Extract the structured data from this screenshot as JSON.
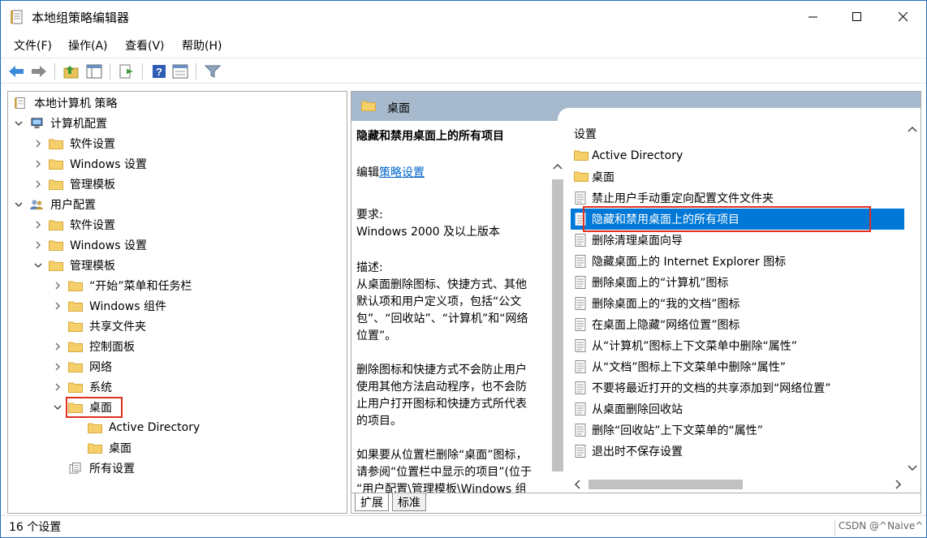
{
  "window": {
    "title": "本地组策略编辑器"
  },
  "menubar": {
    "items": [
      "文件(F)",
      "操作(A)",
      "查看(V)",
      "帮助(H)"
    ]
  },
  "toolbar": {
    "icons": [
      "back-arrow-icon",
      "forward-arrow-icon",
      "up-folder-icon",
      "show-hide-tree-icon",
      "export-list-icon",
      "help-icon",
      "properties-icon",
      "filter-icon"
    ]
  },
  "tree": {
    "root": "本地计算机 策略",
    "computer_config": "计算机配置",
    "computer_children": [
      "软件设置",
      "Windows 设置",
      "管理模板"
    ],
    "user_config": "用户配置",
    "user_children": [
      "软件设置",
      "Windows 设置",
      "管理模板"
    ],
    "admin_children": [
      "“开始”菜单和任务栏",
      "Windows 组件",
      "共享文件夹",
      "控制面板",
      "网络",
      "系统",
      "桌面"
    ],
    "desktop_children": [
      "Active Directory",
      "桌面"
    ],
    "all_settings": "所有设置"
  },
  "right_header": {
    "label": "桌面"
  },
  "description": {
    "title": "隐藏和禁用桌面上的所有项目",
    "edit_prefix": "编辑",
    "edit_link": "策略设置",
    "requirement_label": "要求:",
    "requirement_value": "Windows 2000 及以上版本",
    "desc_label": "描述:",
    "para1_lines": [
      "从桌面删除图标、快捷方式、其他",
      "默认项和用户定义项，包括“公文",
      "包”、“回收站”、“计算机”和“网络",
      "位置”。"
    ],
    "para2_lines": [
      "删除图标和快捷方式不会防止用户",
      "使用其他方法启动程序，也不会防",
      "止用户打开图标和快捷方式所代表",
      "的项目。"
    ],
    "para3_lines": [
      "如果要从位置栏删除“桌面”图标，",
      "请参阅“位置栏中显示的项目”(位于",
      "“用户配置\\管理模板\\Windows 组"
    ]
  },
  "settings_list": {
    "column_header": "设置",
    "folders": [
      "Active Directory",
      "桌面"
    ],
    "items": [
      "禁止用户手动重定向配置文件文件夹",
      "隐藏和禁用桌面上的所有项目",
      "删除清理桌面向导",
      "隐藏桌面上的 Internet Explorer 图标",
      "删除桌面上的“计算机”图标",
      "删除桌面上的“我的文档”图标",
      "在桌面上隐藏“网络位置”图标",
      "从“计算机”图标上下文菜单中删除“属性”",
      "从“文档”图标上下文菜单中删除“属性”",
      "不要将最近打开的文档的共享添加到“网络位置”",
      "从桌面删除回收站",
      "删除“回收站”上下文菜单的“属性”",
      "退出时不保存设置"
    ],
    "selected_index": 1
  },
  "tabs": [
    "扩展",
    "标准"
  ],
  "status": {
    "text": "16 个设置",
    "watermark": "CSDN @^Naive^"
  },
  "colors": {
    "selection": "#0078d7",
    "highlight_box": "#e0301e",
    "header_band": "#a7bacd",
    "folder": "#f5cf6a"
  }
}
